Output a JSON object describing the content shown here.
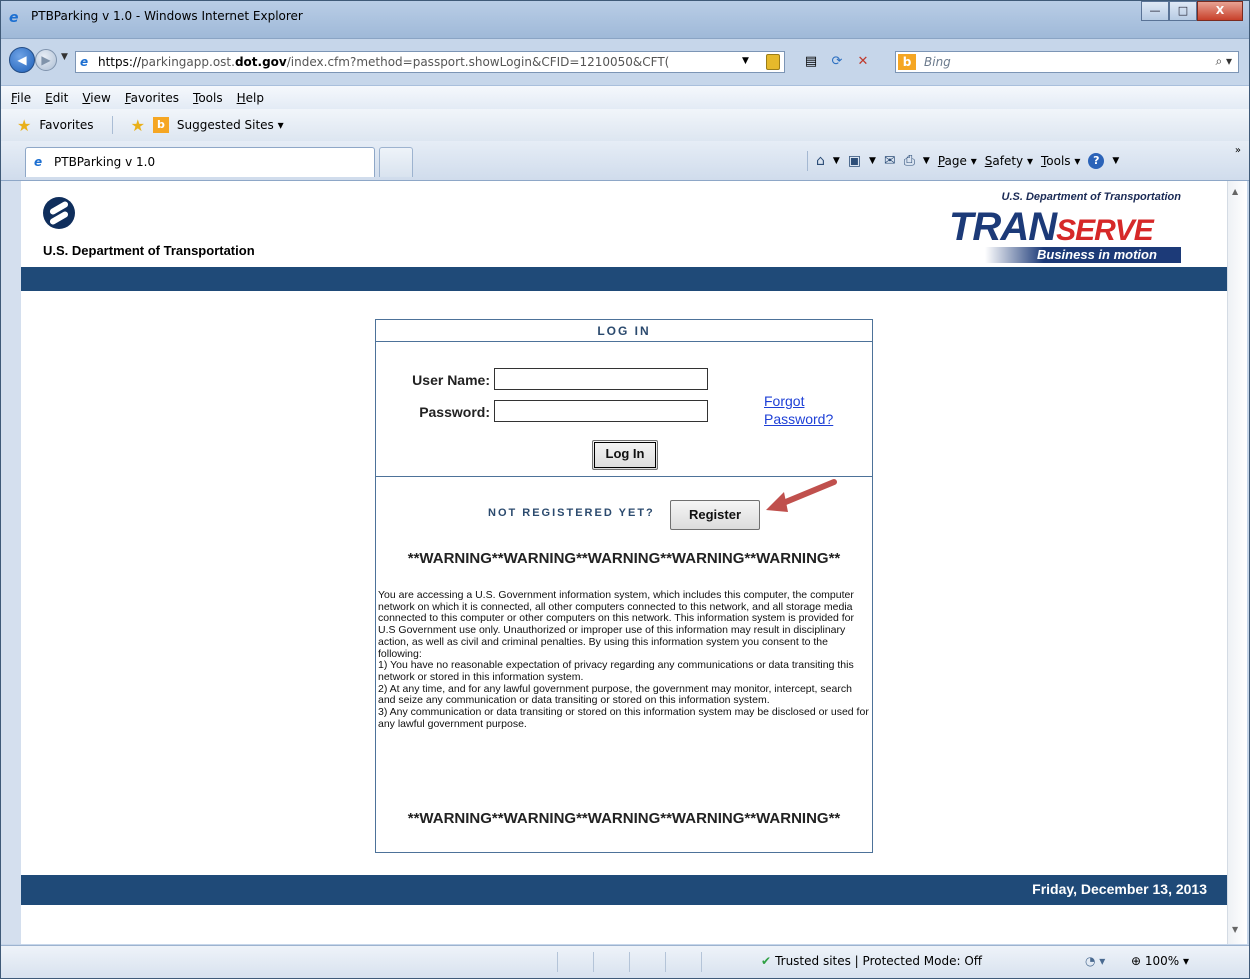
{
  "window": {
    "title": "PTBParking v 1.0 - Windows Internet Explorer",
    "min": "—",
    "max": "□",
    "close": "X"
  },
  "address": {
    "scheme": "https://",
    "host_pre": "parkingapp.ost.",
    "host_bold": "dot.gov",
    "path": "/index.cfm?method=passport.showLogin&CFID=1210050&CFT("
  },
  "search": {
    "placeholder": "Bing"
  },
  "menu": [
    "File",
    "Edit",
    "View",
    "Favorites",
    "Tools",
    "Help"
  ],
  "favorites": {
    "label": "Favorites",
    "suggested": "Suggested Sites ▾"
  },
  "tab": {
    "label": "PTBParking v 1.0"
  },
  "commands": {
    "page": "Page ▾",
    "safety": "Safety ▾",
    "tools": "Tools ▾"
  },
  "header": {
    "org_name": "U.S. Department of Transportation",
    "ts_dept": "U.S. Department of Transportation",
    "ts_tran": "TRAN",
    "ts_serve": "SERVE",
    "ts_tag": "Business in motion"
  },
  "login": {
    "heading": "LOG IN",
    "user_label": "User Name:",
    "password_label": "Password:",
    "user_value": "",
    "password_value": "",
    "forgot": "Forgot Password?",
    "login_button": "Log In",
    "not_registered": "NOT REGISTERED YET?",
    "register_button": "Register",
    "warning": "**WARNING**WARNING**WARNING**WARNING**WARNING**",
    "notice": "You are accessing a U.S. Government information system, which includes this computer, the computer network on which it is connected, all other computers connected to this network, and all storage media connected to this computer or other computers on this network. This information system is provided for U.S Government use only. Unauthorized or improper use of this information may result in disciplinary action, as well as civil and criminal penalties. By using this information system you consent to the following:",
    "items": [
      "1) You have no reasonable expectation of privacy regarding any communications or data transiting this network or stored in this information system.",
      "2) At any time, and for any lawful government purpose, the government may monitor, intercept, search and seize any communication or data transiting or stored on this information system.",
      "3) Any communication or data transiting or stored on this information system may be disclosed or used for any lawful government purpose."
    ]
  },
  "footer": {
    "date": "Friday, December 13, 2013"
  },
  "status": {
    "zone": "Trusted sites | Protected Mode: Off",
    "zoom": "100%"
  },
  "colors": {
    "brand_blue": "#1f4a78",
    "serve_red": "#d62828",
    "link": "#1d3fd6"
  }
}
